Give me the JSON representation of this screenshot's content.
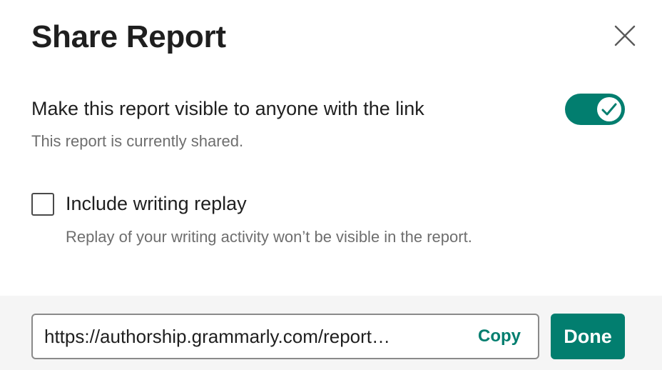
{
  "dialog": {
    "title": "Share Report",
    "close_icon": "close-icon"
  },
  "visibility": {
    "label": "Make this report visible to anyone with the link",
    "status": "This report is currently shared.",
    "toggle_on": true,
    "toggle_icon": "check-icon"
  },
  "replay": {
    "label": "Include writing replay",
    "description": "Replay of your writing activity won’t be visible in the report.",
    "checked": false
  },
  "footer": {
    "link_value": "https://authorship.grammarly.com/report…",
    "copy_label": "Copy",
    "done_label": "Done"
  },
  "colors": {
    "accent": "#027e6f",
    "footer_bg": "#f5f5f5",
    "text_primary": "#1f1f1f",
    "text_secondary": "#6e6e6e"
  }
}
